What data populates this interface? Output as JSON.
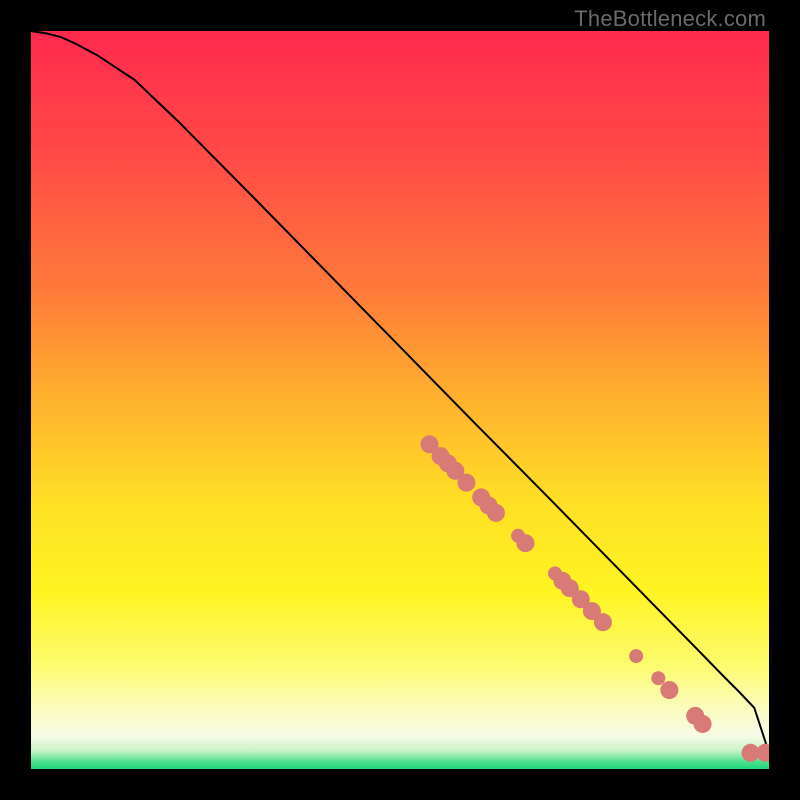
{
  "watermark": {
    "text": "TheBottleneck.com"
  },
  "colors": {
    "point": "#d87a76",
    "curve": "#000000",
    "gradient_stops": [
      {
        "offset": 0.0,
        "color": "#ff2a4e"
      },
      {
        "offset": 0.18,
        "color": "#ff4d45"
      },
      {
        "offset": 0.35,
        "color": "#ff7a3a"
      },
      {
        "offset": 0.5,
        "color": "#ffb22e"
      },
      {
        "offset": 0.64,
        "color": "#ffe026"
      },
      {
        "offset": 0.76,
        "color": "#fff423"
      },
      {
        "offset": 0.86,
        "color": "#fdfb70"
      },
      {
        "offset": 0.92,
        "color": "#fbfcc1"
      },
      {
        "offset": 0.955,
        "color": "#f7fbe6"
      },
      {
        "offset": 0.975,
        "color": "#c9f3c8"
      },
      {
        "offset": 0.99,
        "color": "#4fe08f"
      },
      {
        "offset": 1.0,
        "color": "#1ed47b"
      }
    ]
  },
  "chart_data": {
    "type": "scatter",
    "title": "",
    "xlabel": "",
    "ylabel": "",
    "xlim": [
      0,
      100
    ],
    "ylim": [
      0,
      100
    ],
    "curve": {
      "x": [
        0,
        2,
        4,
        6,
        9,
        14,
        20,
        30,
        40,
        50,
        60,
        70,
        80,
        90,
        94,
        96,
        98,
        100
      ],
      "y": [
        100,
        99.7,
        99.2,
        98.3,
        96.7,
        93.4,
        87.7,
        77.6,
        67.4,
        57.2,
        47.0,
        36.9,
        26.7,
        16.5,
        12.4,
        10.4,
        8.3,
        2.2
      ]
    },
    "series": [
      {
        "name": "points",
        "x": [
          54,
          55.5,
          56.5,
          57.5,
          59,
          61,
          62,
          63,
          66,
          67,
          71,
          72,
          73,
          74.5,
          76,
          77.5,
          82,
          85,
          86.5,
          90,
          91,
          97.5,
          99.5
        ],
        "y": [
          44.0,
          42.4,
          41.4,
          40.4,
          38.8,
          36.8,
          35.7,
          34.7,
          31.6,
          30.6,
          26.5,
          25.5,
          24.5,
          23.0,
          21.4,
          19.9,
          15.3,
          12.3,
          10.7,
          7.2,
          6.1,
          2.2,
          2.2
        ],
        "r": [
          9,
          9,
          9,
          9,
          9,
          9,
          9,
          9,
          7,
          9,
          7,
          9,
          9,
          9,
          9,
          9,
          7,
          7,
          9,
          9,
          9,
          9,
          9
        ]
      }
    ]
  }
}
